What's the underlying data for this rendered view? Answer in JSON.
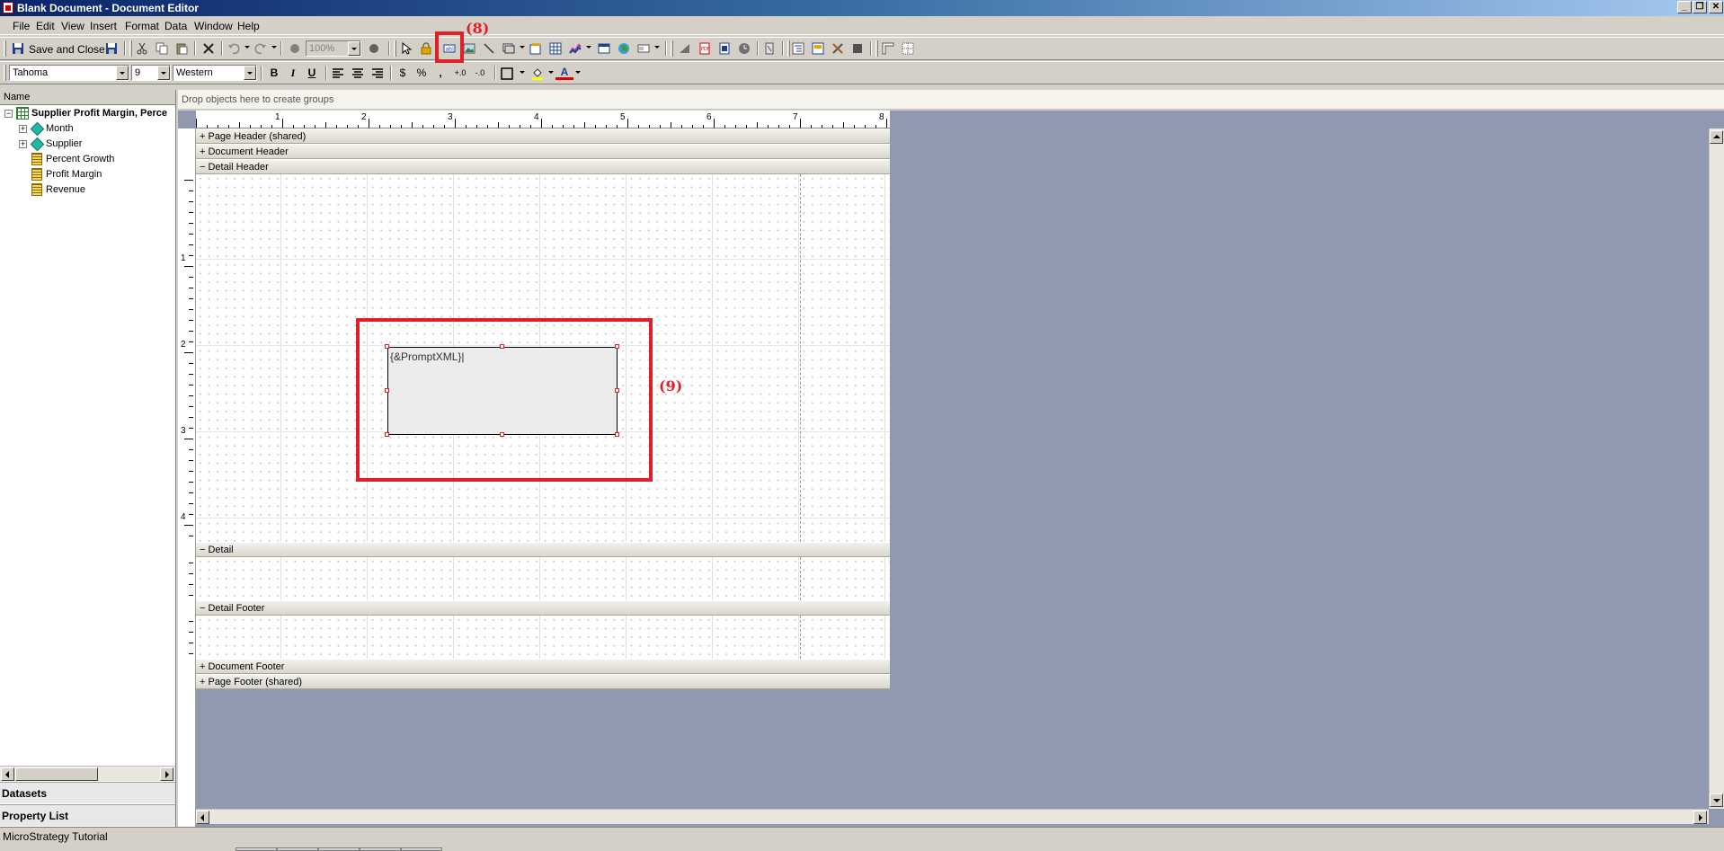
{
  "window": {
    "title": "Blank Document - Document Editor"
  },
  "menu": [
    "File",
    "Edit",
    "View",
    "Insert",
    "Format",
    "Data",
    "Window",
    "Help"
  ],
  "toolbar": {
    "save_close_label": "Save and Close",
    "zoom": "100%"
  },
  "format_bar": {
    "font": "Tahoma",
    "size": "9",
    "script": "Western",
    "bold": "B",
    "italic": "I",
    "underline": "U",
    "currency": "$",
    "percent": "%",
    "comma": ",",
    "inc_decimal": "+.0",
    "dec_decimal": "-.0",
    "font_color_glyph": "A"
  },
  "group_bar": {
    "text": "Drop objects here to create groups"
  },
  "tree": {
    "header": "Name",
    "dataset": "Supplier Profit Margin, Perce",
    "items": [
      {
        "label": "Month",
        "kind": "attribute"
      },
      {
        "label": "Supplier",
        "kind": "attribute"
      },
      {
        "label": "Percent Growth",
        "kind": "metric"
      },
      {
        "label": "Profit Margin",
        "kind": "metric"
      },
      {
        "label": "Revenue",
        "kind": "metric"
      }
    ]
  },
  "left_tabs": {
    "datasets": "Datasets",
    "property_list": "Property List"
  },
  "ruler": {
    "h_numbers": [
      "1",
      "2",
      "3",
      "4",
      "5",
      "6",
      "7",
      "8"
    ],
    "v_numbers": [
      "1",
      "2",
      "3",
      "4"
    ]
  },
  "sections": {
    "page_header": "+ Page Header (shared)",
    "document_header": "+ Document Header",
    "detail_header": "− Detail Header",
    "detail": "− Detail",
    "detail_footer": "− Detail Footer",
    "document_footer": "+ Document Footer",
    "page_footer": "+ Page Footer (shared)"
  },
  "text_field": {
    "value": "{&PromptXML}"
  },
  "annotations": {
    "toolbar_marker": "(8)",
    "textbox_marker": "(9)"
  },
  "status": {
    "text": "MicroStrategy Tutorial"
  },
  "colors": {
    "annotation": "#e21f26",
    "canvas_bg": "#9099b0",
    "title_bar": "#0a246a"
  }
}
